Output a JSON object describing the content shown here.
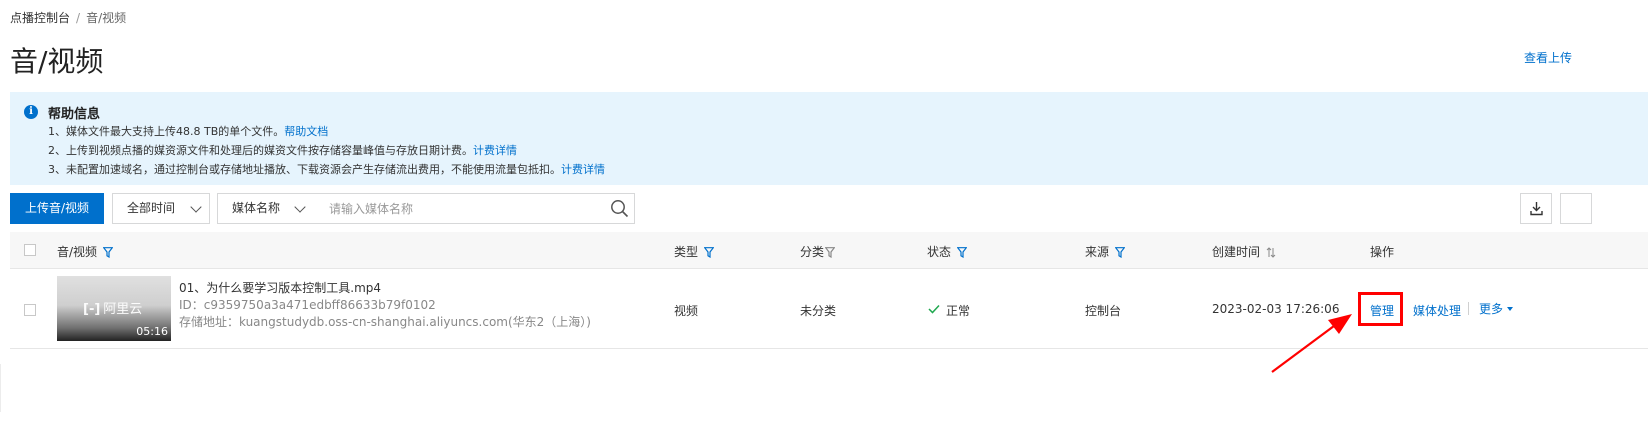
{
  "breadcrumb": {
    "root": "点播控制台",
    "separator": "/",
    "current": "音/视频"
  },
  "page": {
    "title": "音/视频",
    "top_right_link": "查看上传"
  },
  "help": {
    "title": "帮助信息",
    "lines": [
      {
        "text": "1、媒体文件最大支持上传48.8 TB的单个文件。",
        "link": "帮助文档"
      },
      {
        "text": "2、上传到视频点播的媒资源文件和处理后的媒资文件按存储容量峰值与存放日期计费。",
        "link": "计费详情"
      },
      {
        "text": "3、未配置加速域名，通过控制台或存储地址播放、下载资源会产生存储流出费用，不能使用流量包抵扣。",
        "link": "计费详情"
      }
    ]
  },
  "toolbar": {
    "upload_label": "上传音/视频",
    "time_filter": "全部时间",
    "field_select": "媒体名称",
    "search_placeholder": "请输入媒体名称"
  },
  "table": {
    "columns": {
      "media": "音/视频",
      "type": "类型",
      "category": "分类",
      "status": "状态",
      "source": "来源",
      "created": "创建时间",
      "actions": "操作"
    },
    "rows": [
      {
        "thumb_logo": "阿里云",
        "duration": "05:16",
        "name": "01、为什么要学习版本控制工具.mp4",
        "id": "ID：c9359750a3a471edbff86633b79f0102",
        "storage": "存储地址：kuangstudydb.oss-cn-shanghai.aliyuncs.com(华东2（上海）)",
        "type": "视频",
        "category": "未分类",
        "status": "正常",
        "source": "控制台",
        "created": "2023-02-03 17:26:06",
        "actions": {
          "manage": "管理",
          "process": "媒体处理",
          "more": "更多"
        }
      }
    ]
  },
  "colors": {
    "accent": "#0070cc",
    "help_bg": "#e6f4fd",
    "status_ok": "#1fa84f",
    "highlight": "#ff0000"
  },
  "icons": [
    "info-icon",
    "chevron-down-icon",
    "search-icon",
    "download-icon",
    "filter-icon",
    "sort-icon",
    "check-icon",
    "caret-down-icon",
    "arrow-annotation"
  ]
}
